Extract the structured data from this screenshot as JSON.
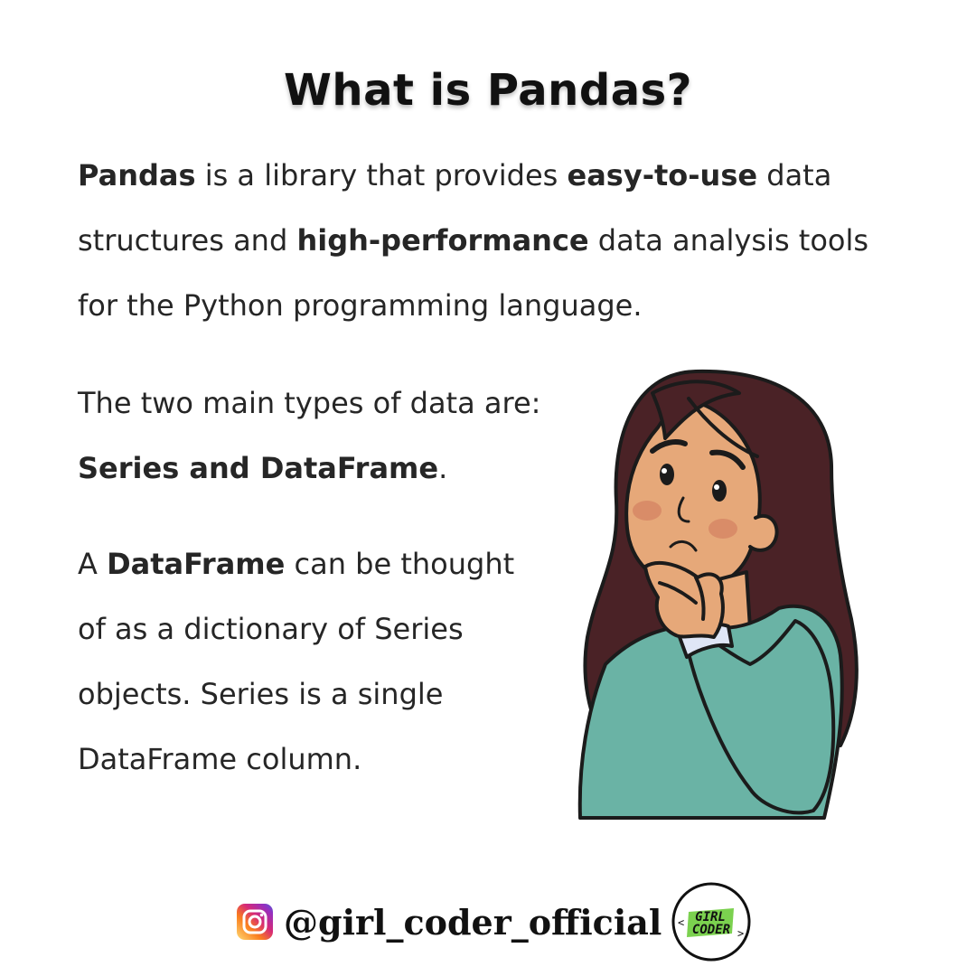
{
  "title": "What is Pandas?",
  "intro": {
    "t1": "Pandas",
    "t2": " is a library that provides ",
    "t3": "easy-to-use",
    "t4": " data structures and ",
    "t5": "high-performance",
    "t6": " data analysis tools for the Python programming language."
  },
  "types": {
    "t1": "The two main types of data are: ",
    "t2": "Series and DataFrame",
    "t3": "."
  },
  "dataframe": {
    "t1": "A ",
    "t2": "DataFrame",
    "t3": " can be thought of as a dictionary of Series objects. Series is a single DataFrame column."
  },
  "footer": {
    "handle": "@girl_coder_official",
    "social_icon": "instagram-icon",
    "logo_line1": "GIRL",
    "logo_line2": "CODER"
  },
  "colors": {
    "sweater": "#6ab3a5",
    "hair": "#4a2226",
    "skin": "#e6a879",
    "logo_green": "#7bd14f"
  }
}
